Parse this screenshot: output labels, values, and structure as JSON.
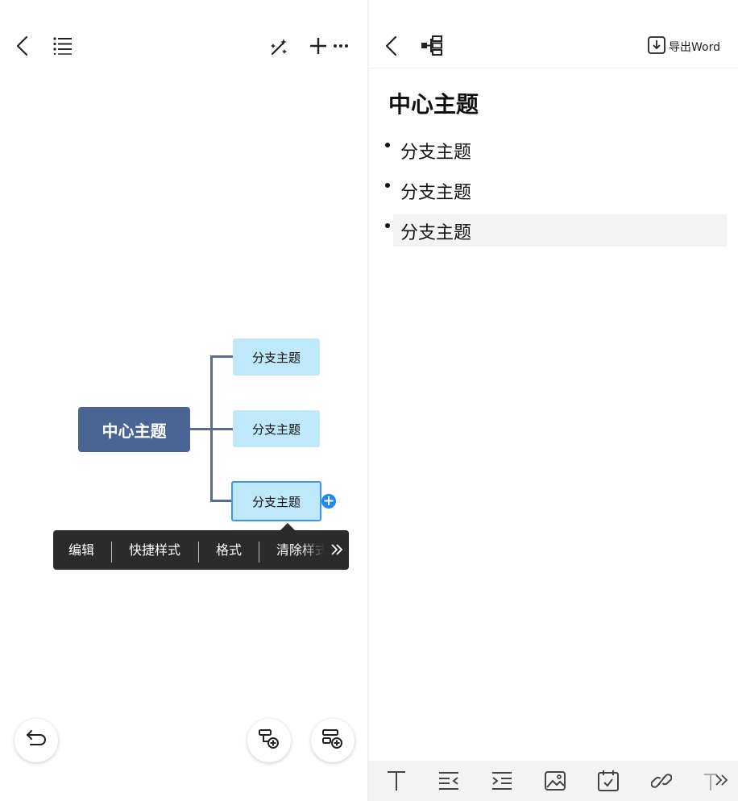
{
  "mindmap": {
    "center_topic": "中心主题",
    "branches": [
      "分支主题",
      "分支主题",
      "分支主题"
    ],
    "selected_branch_index": 2,
    "colors": {
      "center": "#4a6594",
      "branch": "#bfe9fb",
      "selection": "#3c95f0",
      "connector": "#5b6b8f"
    }
  },
  "left_toolbar": {
    "back_icon": "chevron-left-icon",
    "outline_icon": "list-icon",
    "magic_icon": "magic-wand-icon",
    "add_icon": "plus-icon",
    "more_icon": "more-horizontal-icon"
  },
  "context_menu": {
    "items": [
      "编辑",
      "快捷样式",
      "格式",
      "清除样式"
    ],
    "more_icon": "double-chevron-right-icon"
  },
  "floating_buttons": {
    "undo_icon": "undo-icon",
    "add_child_icon": "add-child-topic-icon",
    "add_sibling_icon": "add-sibling-topic-icon"
  },
  "outline": {
    "header": {
      "back_icon": "chevron-left-icon",
      "mindmap_icon": "mindmap-tree-icon",
      "export_label": "导出Word"
    },
    "title": "中心主题",
    "items": [
      "分支主题",
      "分支主题",
      "分支主题"
    ]
  },
  "bottom_toolbar": {
    "icons": [
      "text-icon",
      "outdent-icon",
      "indent-icon",
      "image-icon",
      "calendar-check-icon",
      "link-icon",
      "clear-format-icon",
      "double-chevron-right-icon"
    ]
  }
}
